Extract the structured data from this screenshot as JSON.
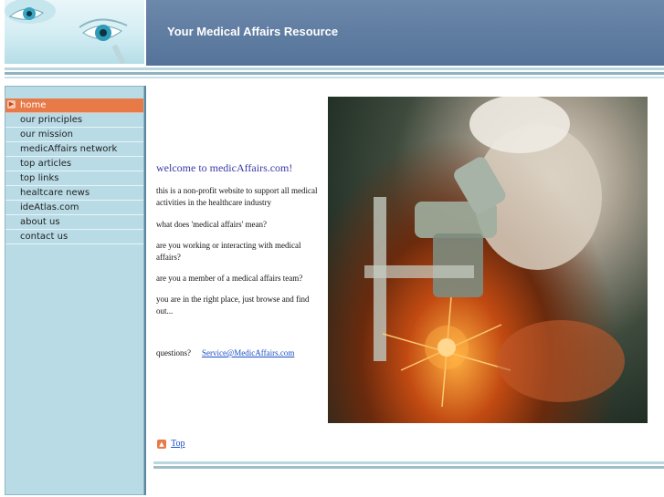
{
  "header": {
    "title": "Your Medical Affairs Resource",
    "logo_icon": "eye-icon"
  },
  "sidebar": {
    "items": [
      {
        "label": "home",
        "active": true
      },
      {
        "label": "our principles"
      },
      {
        "label": "our mission"
      },
      {
        "label": "medicAffairs network"
      },
      {
        "label": "top articles"
      },
      {
        "label": "top links"
      },
      {
        "label": "healtcare news"
      },
      {
        "label": "ideAtlas.com"
      },
      {
        "label": "about us"
      },
      {
        "label": "contact us"
      }
    ]
  },
  "main": {
    "welcome": "welcome to medicAffairs.com!",
    "paragraphs": [
      "this is a non-profit website to support all medical activities in the healthcare industry",
      "what does 'medical affairs' mean?",
      "are you working or interacting with medical affairs?",
      "are you a member of a medical affairs team?",
      "you are in the right place, just browse and find out..."
    ],
    "questions_label": "questions?",
    "email": "Service@MedicAffairs.com",
    "top_link": "Top"
  },
  "colors": {
    "banner": "#5e7ba0",
    "sidebar": "#b9dbe6",
    "active_nav": "#e87a48",
    "link": "#1a4fc4",
    "welcome": "#3a3aa8"
  }
}
